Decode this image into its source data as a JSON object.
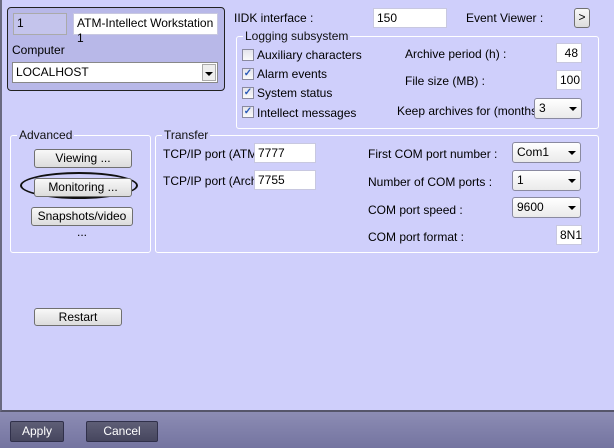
{
  "object": {
    "id": "1",
    "name": "ATM-Intellect Workstation 1",
    "computer_label": "Computer",
    "computer_value": "LOCALHOST"
  },
  "iidk": {
    "label": "IIDK interface :",
    "value": "150"
  },
  "event_viewer": {
    "label": "Event Viewer :",
    "button": ">"
  },
  "logging": {
    "title": "Logging subsystem",
    "checkboxes": [
      {
        "label": "Auxiliary characters",
        "checked": false
      },
      {
        "label": "Alarm events",
        "checked": true
      },
      {
        "label": "System status",
        "checked": true
      },
      {
        "label": "Intellect messages",
        "checked": true
      }
    ],
    "archive_period_label": "Archive period (h) :",
    "archive_period": "48",
    "file_size_label": "File size (MB) :",
    "file_size": "100",
    "keep_label": "Keep archives for (months) :",
    "keep_value": "3"
  },
  "advanced": {
    "title": "Advanced",
    "viewing": "Viewing ...",
    "monitoring": "Monitoring ...",
    "snapshots": "Snapshots/video ..."
  },
  "transfer": {
    "title": "Transfer",
    "tcp_atm_label": "TCP/IP port (ATM) :",
    "tcp_atm": "7777",
    "tcp_archive_label": "TCP/IP port (Archive) :",
    "tcp_archive": "7755",
    "first_com_label": "First COM port number :",
    "first_com": "Com1",
    "num_com_label": "Number of COM ports :",
    "num_com": "1",
    "speed_label": "COM port speed :",
    "speed": "9600",
    "format_label": "COM port format :",
    "format": "8N1"
  },
  "restart": "Restart",
  "footer": {
    "apply": "Apply",
    "cancel": "Cancel"
  }
}
